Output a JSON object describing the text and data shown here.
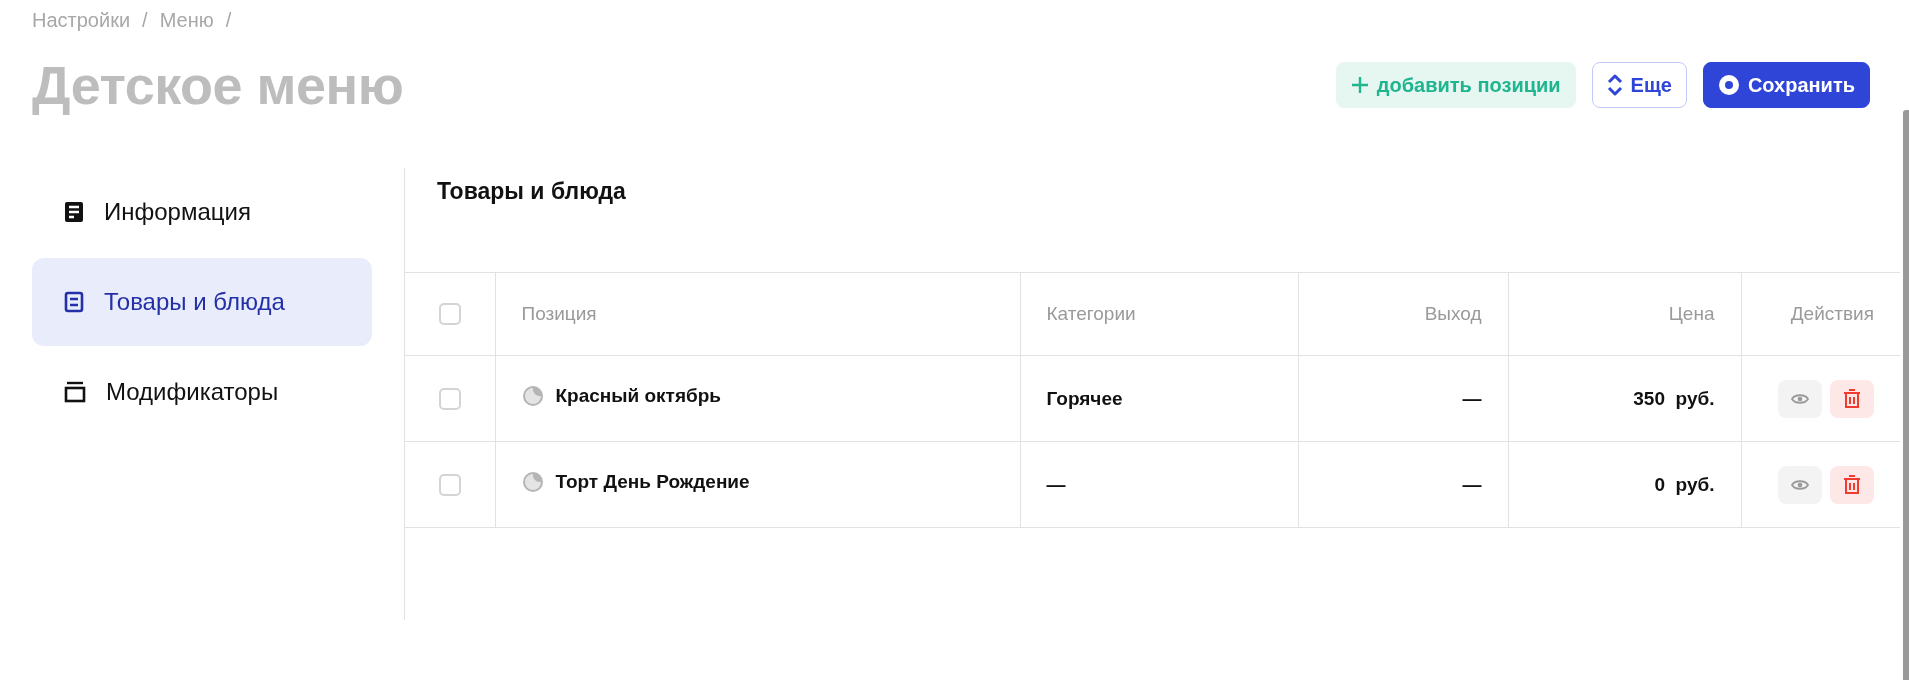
{
  "breadcrumbs": [
    "Настройки",
    "Меню"
  ],
  "breadcrumb_separator": "/",
  "title": "Детское меню",
  "buttons": [
    {
      "kind": "add",
      "label": "добавить позиции"
    },
    {
      "kind": "more",
      "label": "Еще"
    },
    {
      "kind": "save",
      "label": "Сохранить"
    }
  ],
  "sidebar": {
    "items": [
      {
        "kind": "info",
        "label": "Информация",
        "selected": false
      },
      {
        "kind": "list",
        "label": "Товары и блюда",
        "selected": true
      },
      {
        "kind": "modifiers",
        "label": "Модификаторы",
        "selected": false
      }
    ]
  },
  "section_title": "Товары и блюда",
  "table": {
    "select_all_checked": false,
    "columns": [
      "Позиция",
      "Категории",
      "Выход",
      "Цена",
      "Действия"
    ],
    "rows": [
      {
        "checked": false,
        "position": "Красный октябрь",
        "category": "Горячее",
        "yield": "—",
        "price": "350",
        "currency": "руб."
      },
      {
        "checked": false,
        "position": "Торт День Рождение",
        "category": "—",
        "yield": "—",
        "price": "0",
        "currency": "руб."
      }
    ]
  }
}
